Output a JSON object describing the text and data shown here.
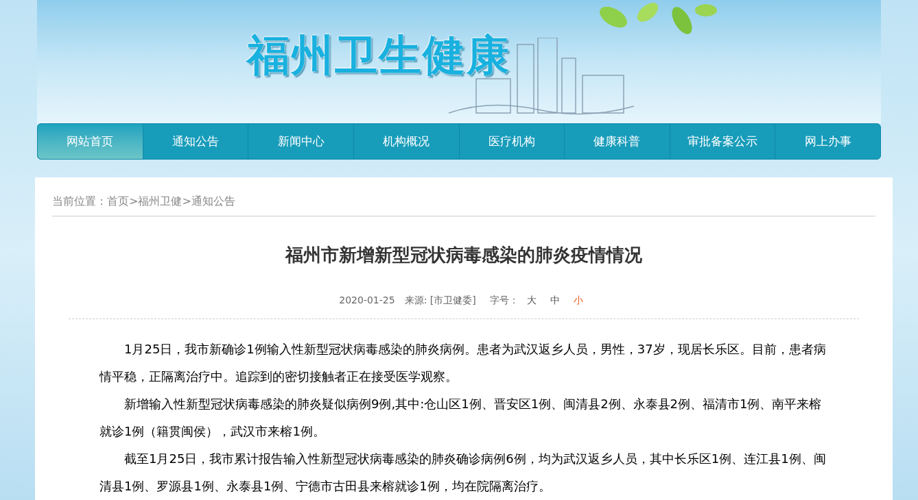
{
  "header": {
    "logo": "福州卫生健康"
  },
  "nav": [
    {
      "label": "网站首页",
      "selected": true
    },
    {
      "label": "通知公告",
      "selected": false
    },
    {
      "label": "新闻中心",
      "selected": false
    },
    {
      "label": "机构概况",
      "selected": false
    },
    {
      "label": "医疗机构",
      "selected": false
    },
    {
      "label": "健康科普",
      "selected": false
    },
    {
      "label": "审批备案公示",
      "selected": false
    },
    {
      "label": "网上办事",
      "selected": false
    }
  ],
  "breadcrumb": {
    "label": "当前位置：",
    "separator": ">",
    "items": [
      "首页",
      "福州卫健",
      "通知公告"
    ]
  },
  "article": {
    "title": "福州市新增新型冠状病毒感染的肺炎疫情情况",
    "date": "2020-01-25",
    "source": "来源: [市卫健委]",
    "font_size_label": "字号：",
    "font_sizes": [
      {
        "label": "大",
        "selected": false
      },
      {
        "label": "中",
        "selected": false
      },
      {
        "label": "小",
        "selected": true
      }
    ],
    "paragraphs": [
      "1月25日，我市新确诊1例输入性新型冠状病毒感染的肺炎病例。患者为武汉返乡人员，男性，37岁，现居长乐区。目前，患者病情平稳，正隔离治疗中。追踪到的密切接触者正在接受医学观察。",
      "新增输入性新型冠状病毒感染的肺炎疑似病例9例,其中:仓山区1例、晋安区1例、闽清县2例、永泰县2例、福清市1例、南平来榕就诊1例（籍贯闽侯），武汉市来榕1例。",
      "截至1月25日，我市累计报告输入性新型冠状病毒感染的肺炎确诊病例6例，均为武汉返乡人员，其中长乐区1例、连江县1例、闽清县1例、罗源县1例、永泰县1例、宁德市古田县来榕就诊1例，均在院隔离治疗。"
    ]
  }
}
